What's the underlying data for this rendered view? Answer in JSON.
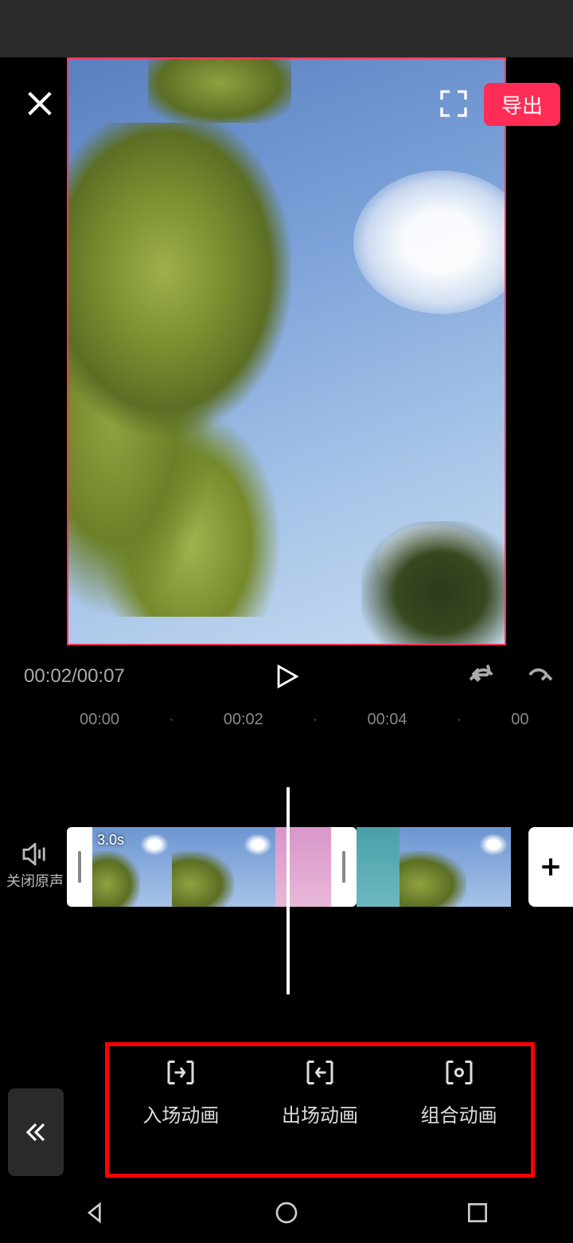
{
  "header": {
    "export_label": "导出"
  },
  "playback": {
    "current_time": "00:02",
    "total_time": "00:07"
  },
  "ruler": [
    "00:00",
    "·",
    "00:02",
    "·",
    "00:04",
    "·",
    "00"
  ],
  "mute": {
    "label": "关闭原声"
  },
  "clip": {
    "duration_label": "3.0s"
  },
  "tools": {
    "in_anim": "入场动画",
    "out_anim": "出场动画",
    "combo_anim": "组合动画"
  }
}
